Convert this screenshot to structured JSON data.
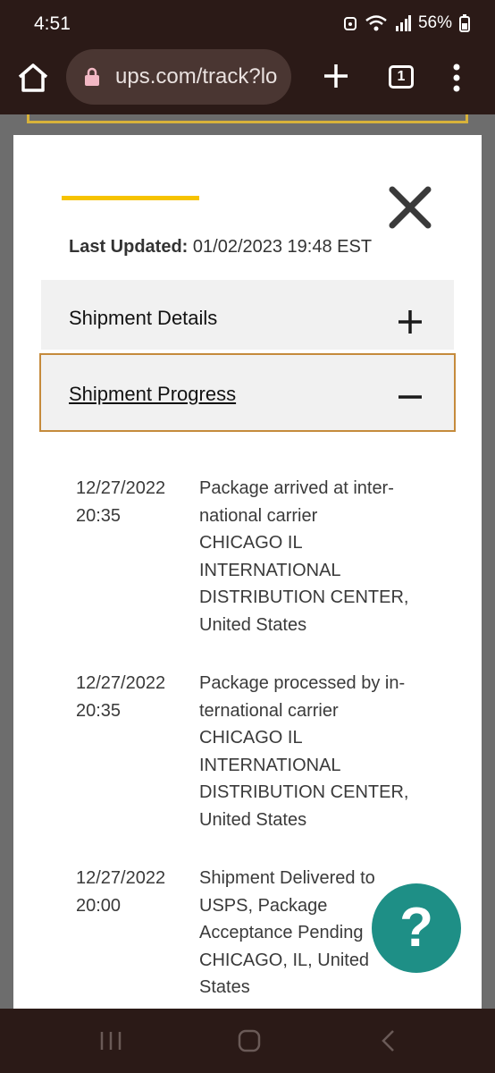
{
  "status_bar": {
    "time": "4:51",
    "battery": "56%"
  },
  "browser": {
    "url": "ups.com/track?lo",
    "tab_count": "1"
  },
  "modal": {
    "last_updated_label": "Last Updated:",
    "last_updated_value": "01/02/2023 19:48 EST",
    "sections": {
      "details": {
        "title": "Shipment Details",
        "icon": "plus-icon"
      },
      "progress": {
        "title": "Shipment Progress",
        "icon": "minus-icon"
      }
    },
    "events": [
      {
        "date": "12/27/2022",
        "time": "20:35",
        "lines": [
          "Package arrived at inter-",
          "national carrier",
          "CHICAGO IL",
          "INTERNATIONAL",
          "DISTRIBUTION CENTER,",
          "United States"
        ]
      },
      {
        "date": "12/27/2022",
        "time": "20:35",
        "lines": [
          "Package processed by in-",
          "ternational carrier",
          "CHICAGO IL",
          "INTERNATIONAL",
          "DISTRIBUTION CENTER,",
          "United States"
        ]
      },
      {
        "date": "12/27/2022",
        "time": "20:00",
        "lines": [
          "Shipment Delivered to",
          "USPS, Package",
          "Acceptance Pending",
          "CHICAGO, IL, United",
          "States"
        ]
      }
    ]
  },
  "help_button": {
    "label": "?"
  },
  "colors": {
    "accent": "#f6c300",
    "help": "#1e8f86",
    "highlight_border": "#c58b3c",
    "chrome": "#2b1a17"
  }
}
